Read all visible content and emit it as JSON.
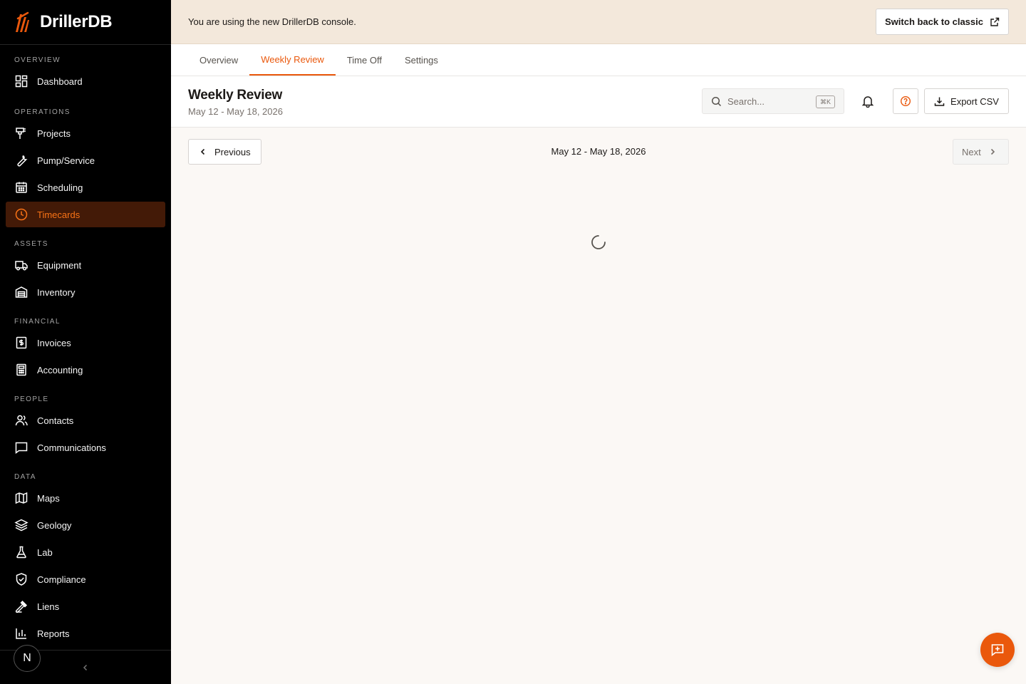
{
  "brand": {
    "name": "DrillerDB",
    "accent": "#ea580c"
  },
  "sidebar": {
    "sections": [
      {
        "label": "OVERVIEW",
        "items": [
          {
            "label": "Dashboard",
            "icon": "dashboard-icon"
          }
        ]
      },
      {
        "label": "OPERATIONS",
        "items": [
          {
            "label": "Projects",
            "icon": "drill-icon"
          },
          {
            "label": "Pump/Service",
            "icon": "wrench-icon"
          },
          {
            "label": "Scheduling",
            "icon": "calendar-icon"
          },
          {
            "label": "Timecards",
            "icon": "clock-icon",
            "active": true
          }
        ]
      },
      {
        "label": "ASSETS",
        "items": [
          {
            "label": "Equipment",
            "icon": "truck-icon"
          },
          {
            "label": "Inventory",
            "icon": "warehouse-icon"
          }
        ]
      },
      {
        "label": "FINANCIAL",
        "items": [
          {
            "label": "Invoices",
            "icon": "invoice-icon"
          },
          {
            "label": "Accounting",
            "icon": "calculator-icon"
          }
        ]
      },
      {
        "label": "PEOPLE",
        "items": [
          {
            "label": "Contacts",
            "icon": "users-icon"
          },
          {
            "label": "Communications",
            "icon": "message-icon"
          }
        ]
      },
      {
        "label": "DATA",
        "items": [
          {
            "label": "Maps",
            "icon": "map-icon"
          },
          {
            "label": "Geology",
            "icon": "layers-icon"
          },
          {
            "label": "Lab",
            "icon": "flask-icon"
          },
          {
            "label": "Compliance",
            "icon": "shield-icon"
          },
          {
            "label": "Liens",
            "icon": "gavel-icon"
          },
          {
            "label": "Reports",
            "icon": "bar-chart-icon"
          }
        ]
      }
    ],
    "avatar_initial": "N"
  },
  "banner": {
    "message": "You are using the new DrillerDB console.",
    "button_label": "Switch back to classic"
  },
  "tabs": [
    {
      "label": "Overview"
    },
    {
      "label": "Weekly Review",
      "active": true
    },
    {
      "label": "Time Off"
    },
    {
      "label": "Settings"
    }
  ],
  "header": {
    "title": "Weekly Review",
    "subtitle": "May 12 - May 18, 2026",
    "search_placeholder": "Search...",
    "search_shortcut": "⌘K",
    "export_label": "Export CSV"
  },
  "week_nav": {
    "previous_label": "Previous",
    "range_label": "May 12 - May 18, 2026",
    "next_label": "Next"
  },
  "state": {
    "loading": true
  }
}
